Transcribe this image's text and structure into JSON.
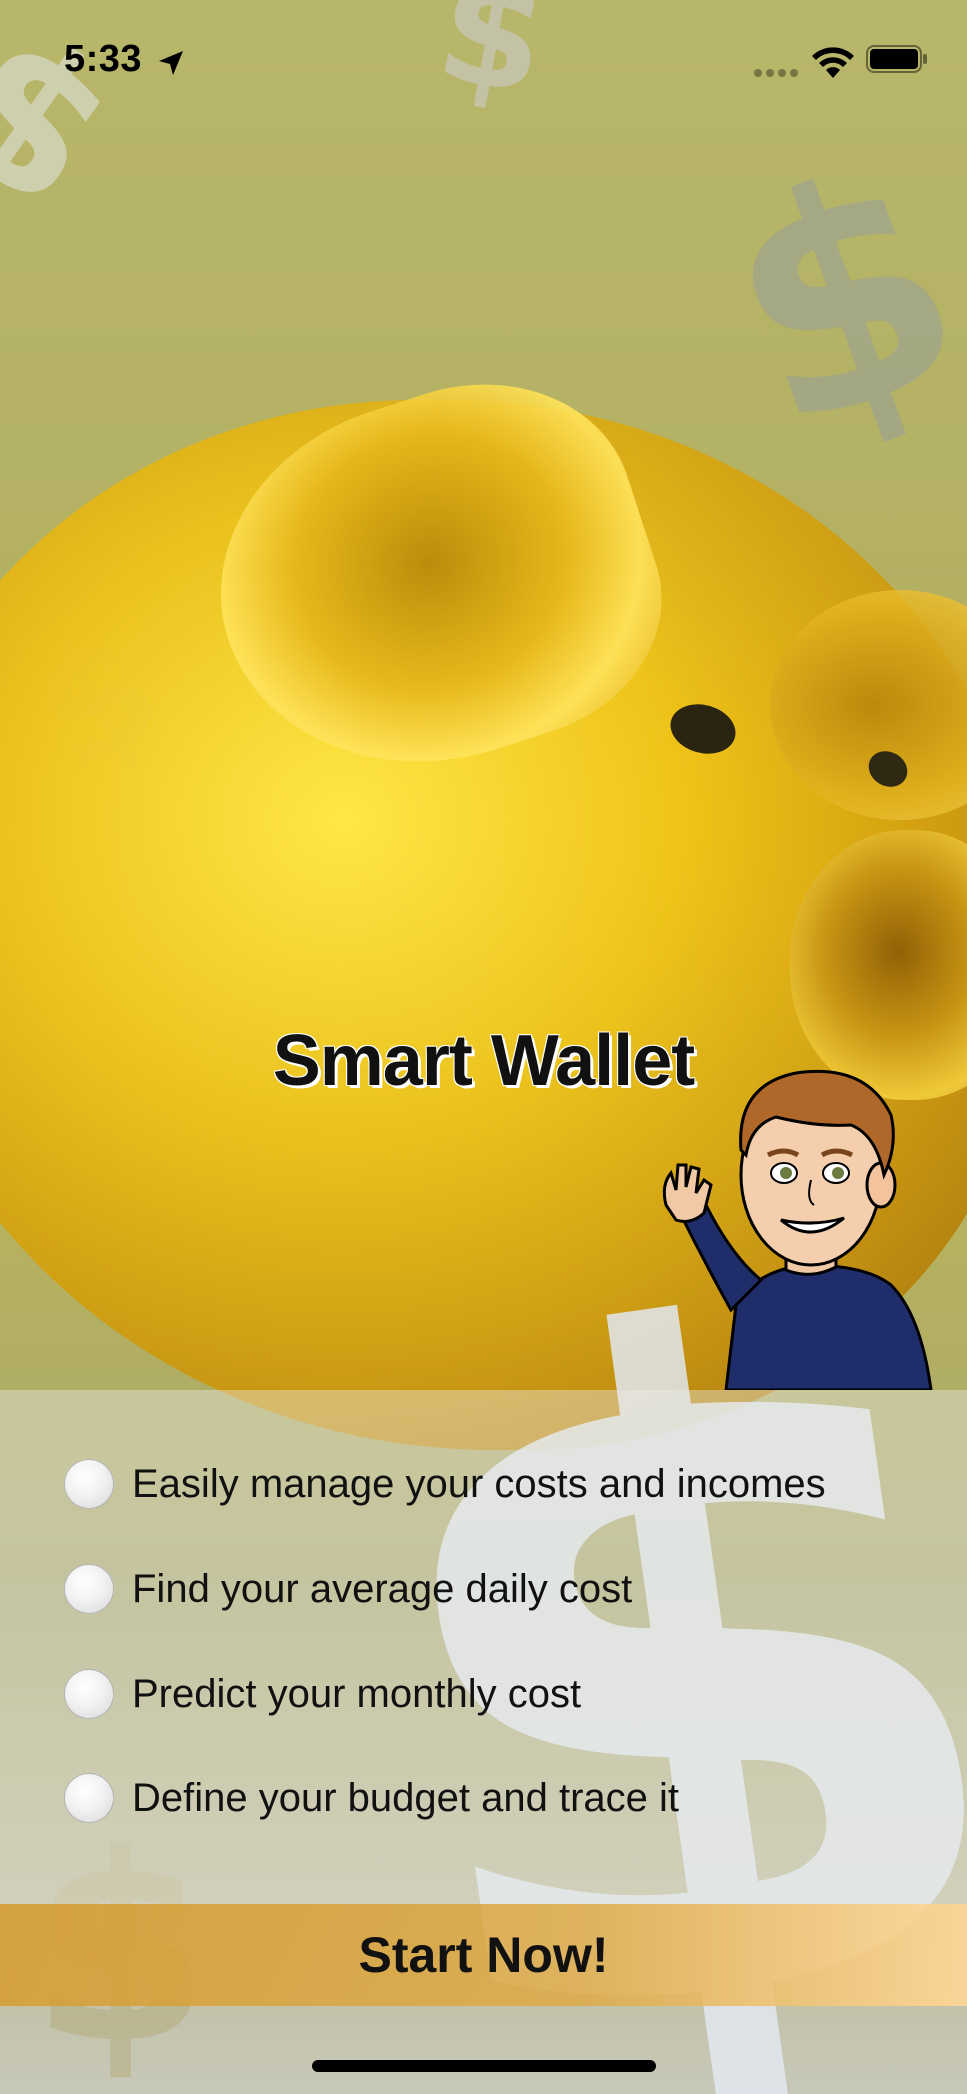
{
  "status_bar": {
    "time": "5:33",
    "icons": [
      "location-arrow-icon",
      "cellular-signal-icon",
      "wifi-icon",
      "battery-icon"
    ]
  },
  "app": {
    "title": "Smart Wallet"
  },
  "features": [
    {
      "label": "Easily manage your costs and incomes",
      "selected": false
    },
    {
      "label": "Find your average daily cost",
      "selected": false
    },
    {
      "label": "Predict your monthly cost",
      "selected": false
    },
    {
      "label": "Define your budget and trace it",
      "selected": false
    }
  ],
  "cta": {
    "label": "Start Now!"
  },
  "colors": {
    "title": "#111111",
    "cta_background": "#d69e32",
    "panel_background": "#ebebe6"
  }
}
